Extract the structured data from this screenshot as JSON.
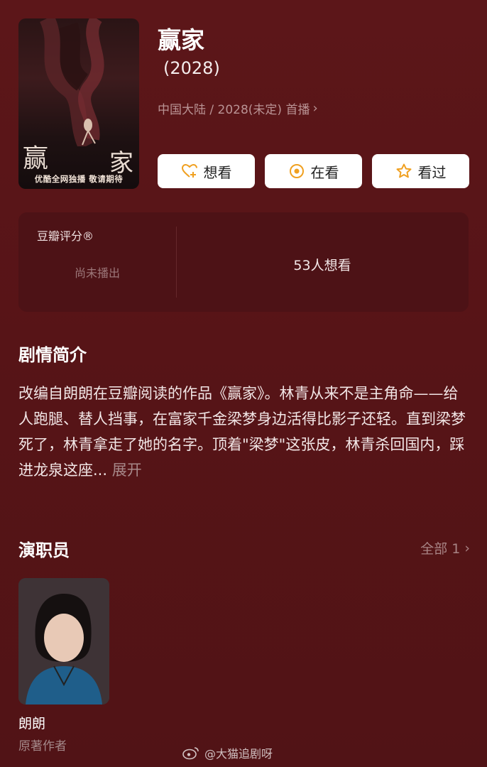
{
  "show": {
    "title": "赢家",
    "year": "(2028)",
    "meta": "中国大陆 / 2028(未定) 首播",
    "poster": {
      "chars": [
        "赢",
        "家"
      ],
      "tagline": "优酷全网独播 敬请期待"
    }
  },
  "actions": [
    {
      "label": "想看",
      "icon": "heart-plus-icon"
    },
    {
      "label": "在看",
      "icon": "target-icon"
    },
    {
      "label": "看过",
      "icon": "star-icon"
    }
  ],
  "rating": {
    "label": "豆瓣评分®",
    "status": "尚未播出",
    "want_count": "53人想看"
  },
  "synopsis": {
    "heading": "剧情简介",
    "text": "改编自朗朗在豆瓣阅读的作品《赢家》。林青从来不是主角命——给人跑腿、替人挡事，在富家千金梁梦身边活得比影子还轻。直到梁梦死了，林青拿走了她的名字。顶着\"梁梦\"这张皮，林青杀回国内，踩进龙泉这座...",
    "more": "展开"
  },
  "cast": {
    "heading": "演职员",
    "all_label": "全部 1",
    "members": [
      {
        "name": "朗朗",
        "role": "原著作者"
      }
    ]
  },
  "watermark": "@大猫追剧呀"
}
